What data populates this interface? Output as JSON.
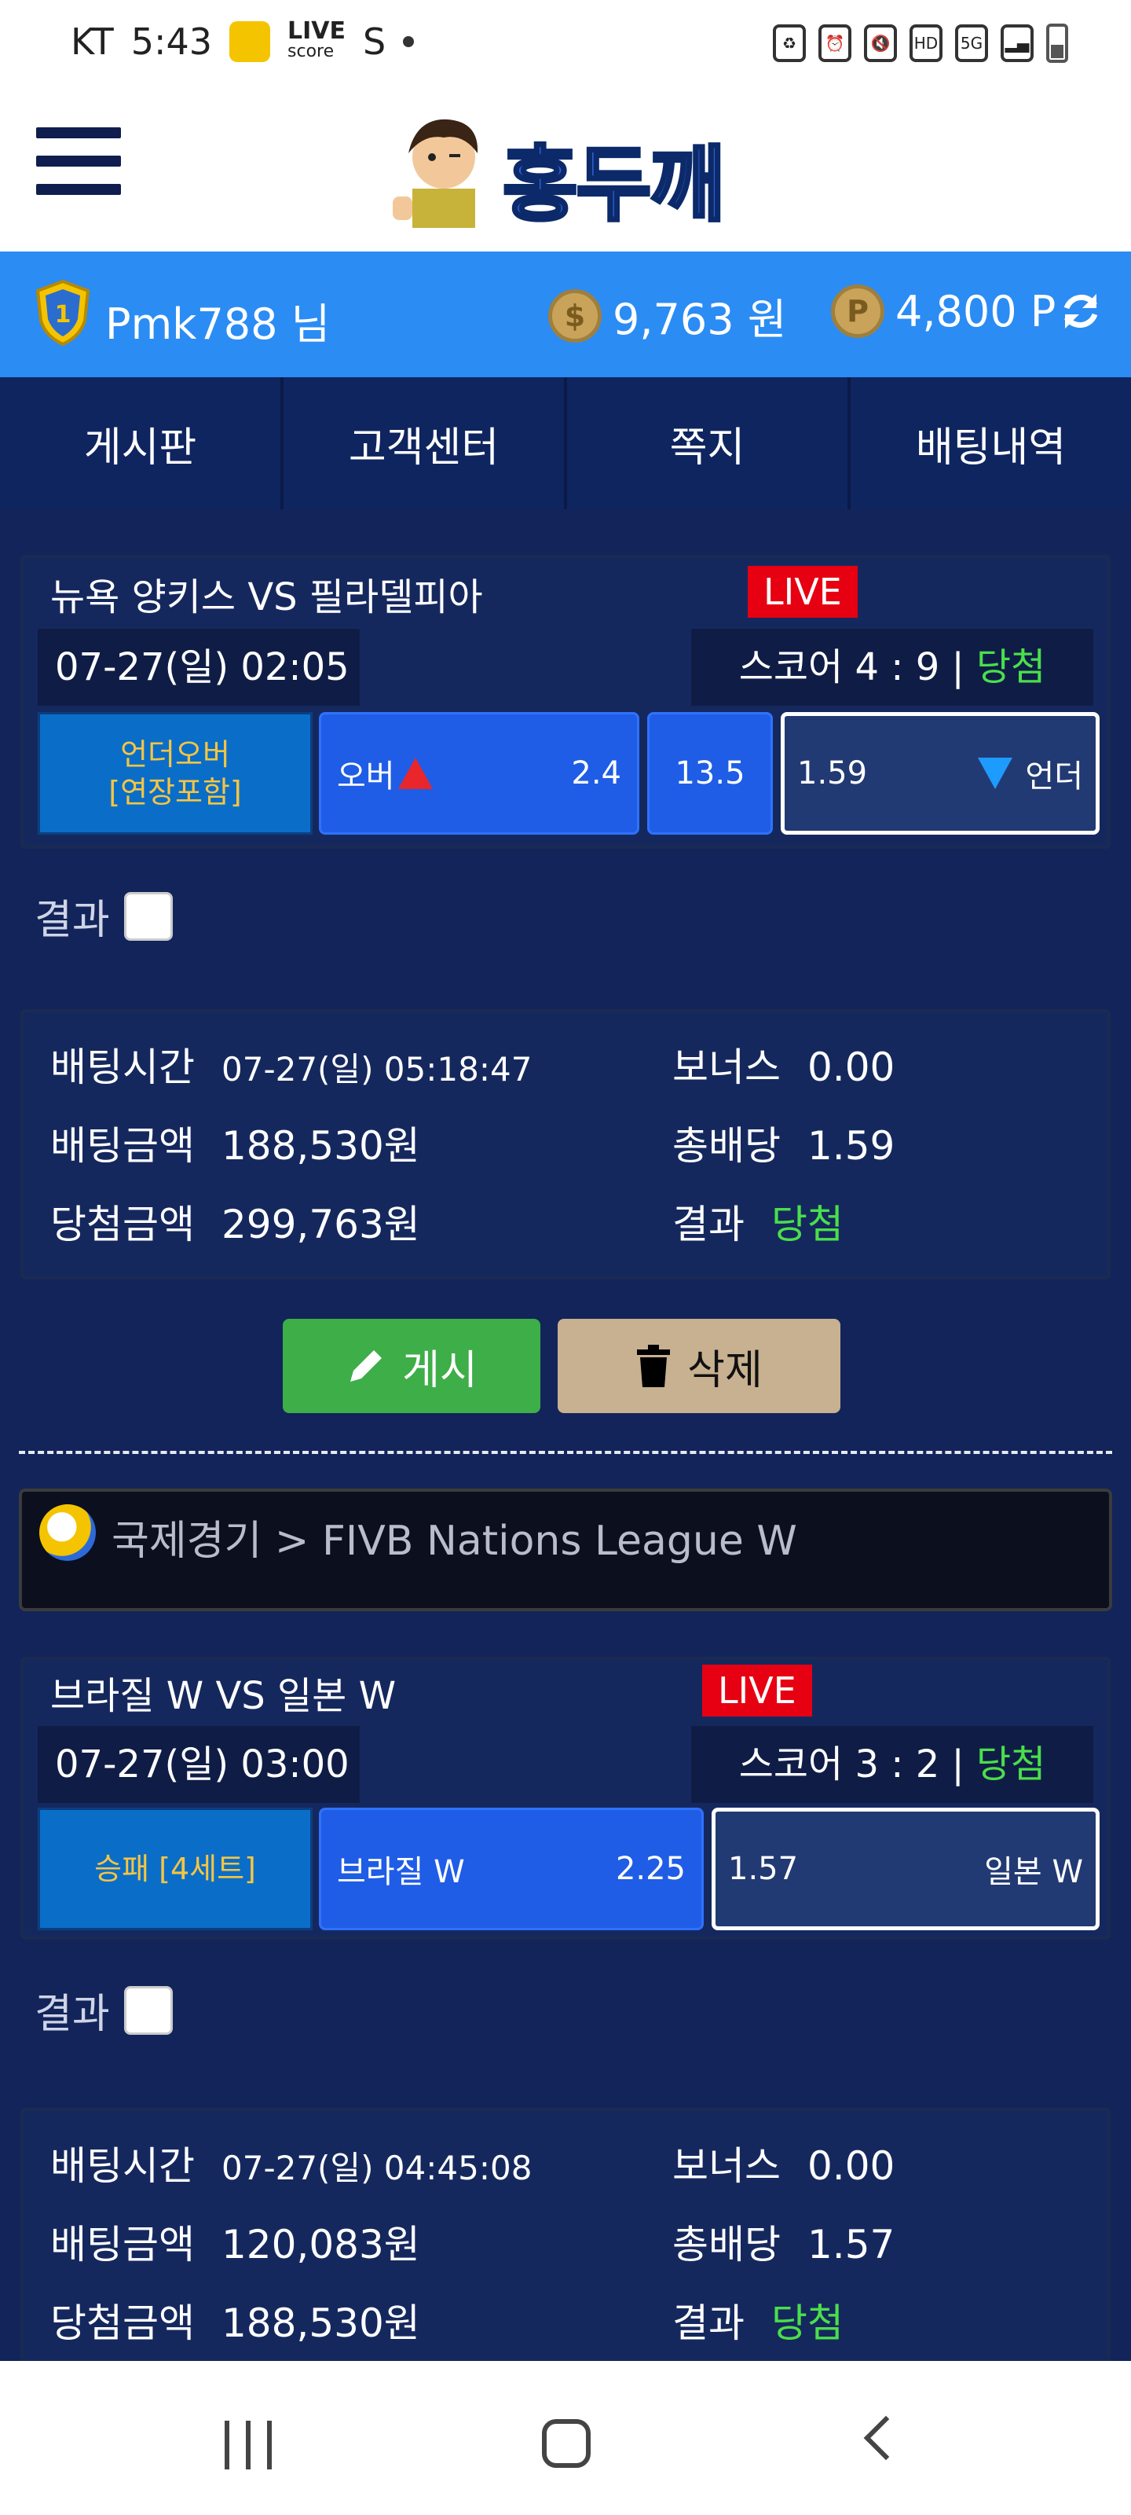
{
  "status_bar": {
    "carrier": "KT",
    "time": "5:43",
    "live_label": "LIVE",
    "live_sub": "score",
    "s_label": "S",
    "icons": [
      "recycle-icon",
      "alarm-icon",
      "mute-icon",
      "hd-icon",
      "5g-icon",
      "signal-icon",
      "battery-icon"
    ]
  },
  "header": {
    "logo_text": "홍두깨"
  },
  "user": {
    "name": "Pmk788 님",
    "money": "9,763 원",
    "points": "4,800 P",
    "coin_money": "$",
    "coin_points": "P",
    "shield_number": "1"
  },
  "nav": {
    "items": [
      "게시판",
      "고객센터",
      "쪽지",
      "배팅내역"
    ]
  },
  "bets": [
    {
      "teams": "뉴욕 양키스 VS 필라델피아",
      "live": "LIVE",
      "date": "07-27(일) 02:05",
      "score_prefix": "스코어 4 : 9 |",
      "score_result": "당첨",
      "type_line1": "언더오버",
      "type_line2": "[연장포함]",
      "opt1_label": "오버",
      "opt1_odds": "2.4",
      "mid": "13.5",
      "opt2_odds": "1.59",
      "opt2_label": "언더",
      "result_label": "결과",
      "bet_time_label": "배팅시간",
      "bet_time": "07-27(일) 05:18:47",
      "bet_amount_label": "배팅금액",
      "bet_amount": "188,530원",
      "win_amount_label": "당첨금액",
      "win_amount": "299,763원",
      "bonus_label": "보너스",
      "bonus": "0.00",
      "total_odds_label": "총배당",
      "total_odds": "1.59",
      "result_text_label": "결과",
      "result_text": "당첨"
    },
    {
      "teams": "브라질 W VS 일본 W",
      "live": "LIVE",
      "date": "07-27(일) 03:00",
      "score_prefix": "스코어 3 : 2 |",
      "score_result": "당첨",
      "type_line1": "승패 [4세트]",
      "opt1_label": "브라질 W",
      "opt1_odds": "2.25",
      "opt2_odds": "1.57",
      "opt2_label": "일본 W",
      "result_label": "결과",
      "bet_time_label": "배팅시간",
      "bet_time": "07-27(일) 04:45:08",
      "bet_amount_label": "배팅금액",
      "bet_amount": "120,083원",
      "win_amount_label": "당첨금액",
      "win_amount": "188,530원",
      "bonus_label": "보너스",
      "bonus": "0.00",
      "total_odds_label": "총배당",
      "total_odds": "1.57",
      "result_text_label": "결과",
      "result_text": "당첨"
    }
  ],
  "actions": {
    "post": "게시",
    "delete": "삭제"
  },
  "league": {
    "text": "국제경기 > FIVB Nations League W"
  },
  "colors": {
    "accent": "#2b8cf4",
    "nav_bg": "#0f2560",
    "win": "#4adf4a",
    "live": "#e60012",
    "post": "#3eae48",
    "delete": "#c8b190"
  }
}
